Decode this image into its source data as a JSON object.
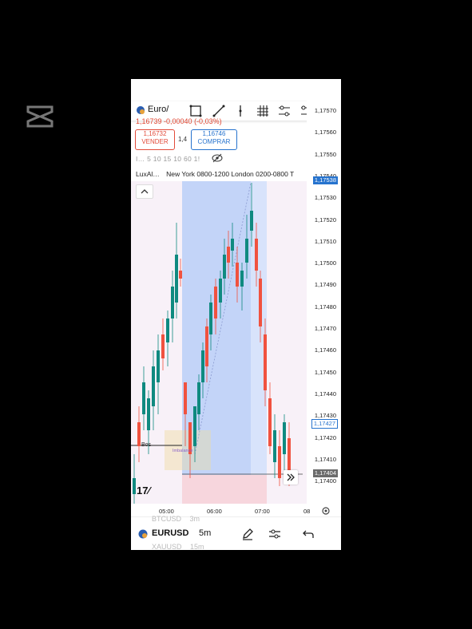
{
  "header": {
    "symbol": "Euro/",
    "price_change": "1,16739 -0,00040 (-0,03%)",
    "sell_price": "1,16732",
    "sell_label": "VENDER",
    "buy_price": "1,16746",
    "buy_label": "COMPRAR",
    "quantity": "1,4",
    "intervals": "I… 5 10 15 10 60 1!",
    "indicator_name": "LuxAl…",
    "sessions_text": "New York 0800-1200 London 0200-0800 T"
  },
  "price_axis": {
    "ticks": [
      "1,17570",
      "1,17560",
      "1,17550",
      "1,17540",
      "1,17530",
      "1,17520",
      "1,17510",
      "1,17500",
      "1,17490",
      "1,17480",
      "1,17470",
      "1,17460",
      "1,17450",
      "1,17440",
      "1,17430",
      "1,17420",
      "1,17410",
      "1,17400"
    ],
    "high_label": "1,17538",
    "current_label": "1,17427",
    "low_label": "1,17404"
  },
  "time_axis": {
    "ticks": [
      "05:00",
      "06:00",
      "07:00",
      "08"
    ]
  },
  "chart": {
    "bos_label": "Bos",
    "imbalance_label": "Imbalance",
    "colors": {
      "up": "#0f8a80",
      "down": "#f0523f",
      "ny_session": "#c7d6f8",
      "london_session": "#f6eef8",
      "accent": "#2673ce"
    }
  },
  "bottom": {
    "symbol_above": "BTCUSD",
    "symbol_above_tf": "3m",
    "symbol": "EURUSD",
    "timeframe": "5m",
    "symbol_below": "XAUUSD",
    "symbol_below_tf": "15m"
  }
}
